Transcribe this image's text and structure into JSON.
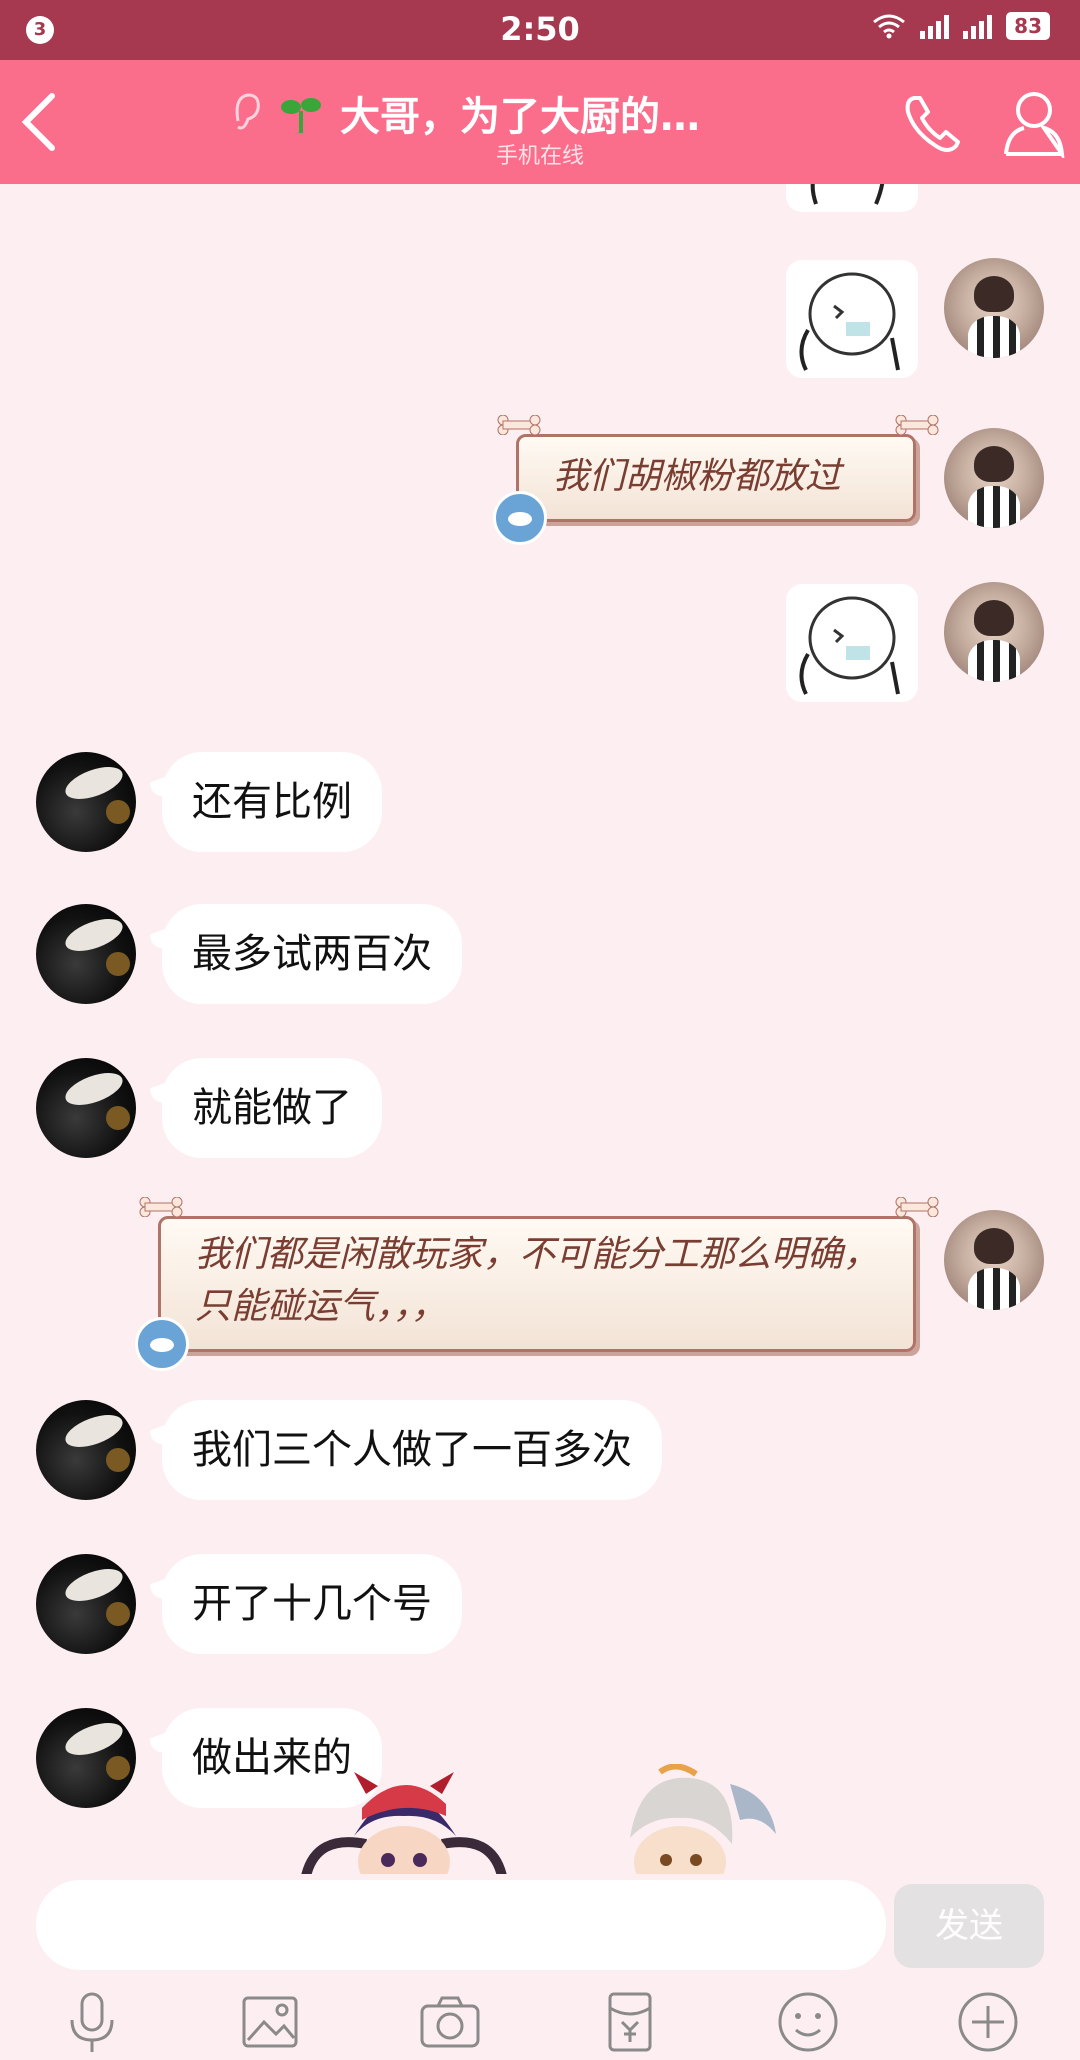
{
  "status_bar": {
    "notification_count": "3",
    "time": "2:50",
    "battery": "83"
  },
  "header": {
    "title": "大哥，为了大厨的…",
    "subtitle": "手机在线"
  },
  "messages": {
    "m1": "我们胡椒粉都放过",
    "m2": "还有比例",
    "m3": "最多试两百次",
    "m4": "就能做了",
    "m5": "我们都是闲散玩家，不可能分工那么明确，只能碰运气，，，",
    "m6": "我们三个人做了一百多次",
    "m7": "开了十几个号",
    "m8": "做出来的"
  },
  "input": {
    "placeholder": "",
    "send_label": "发送"
  },
  "colors": {
    "status_bar": "#a6384f",
    "header": "#fa6e8c",
    "chat_bg": "#fdeef1"
  }
}
